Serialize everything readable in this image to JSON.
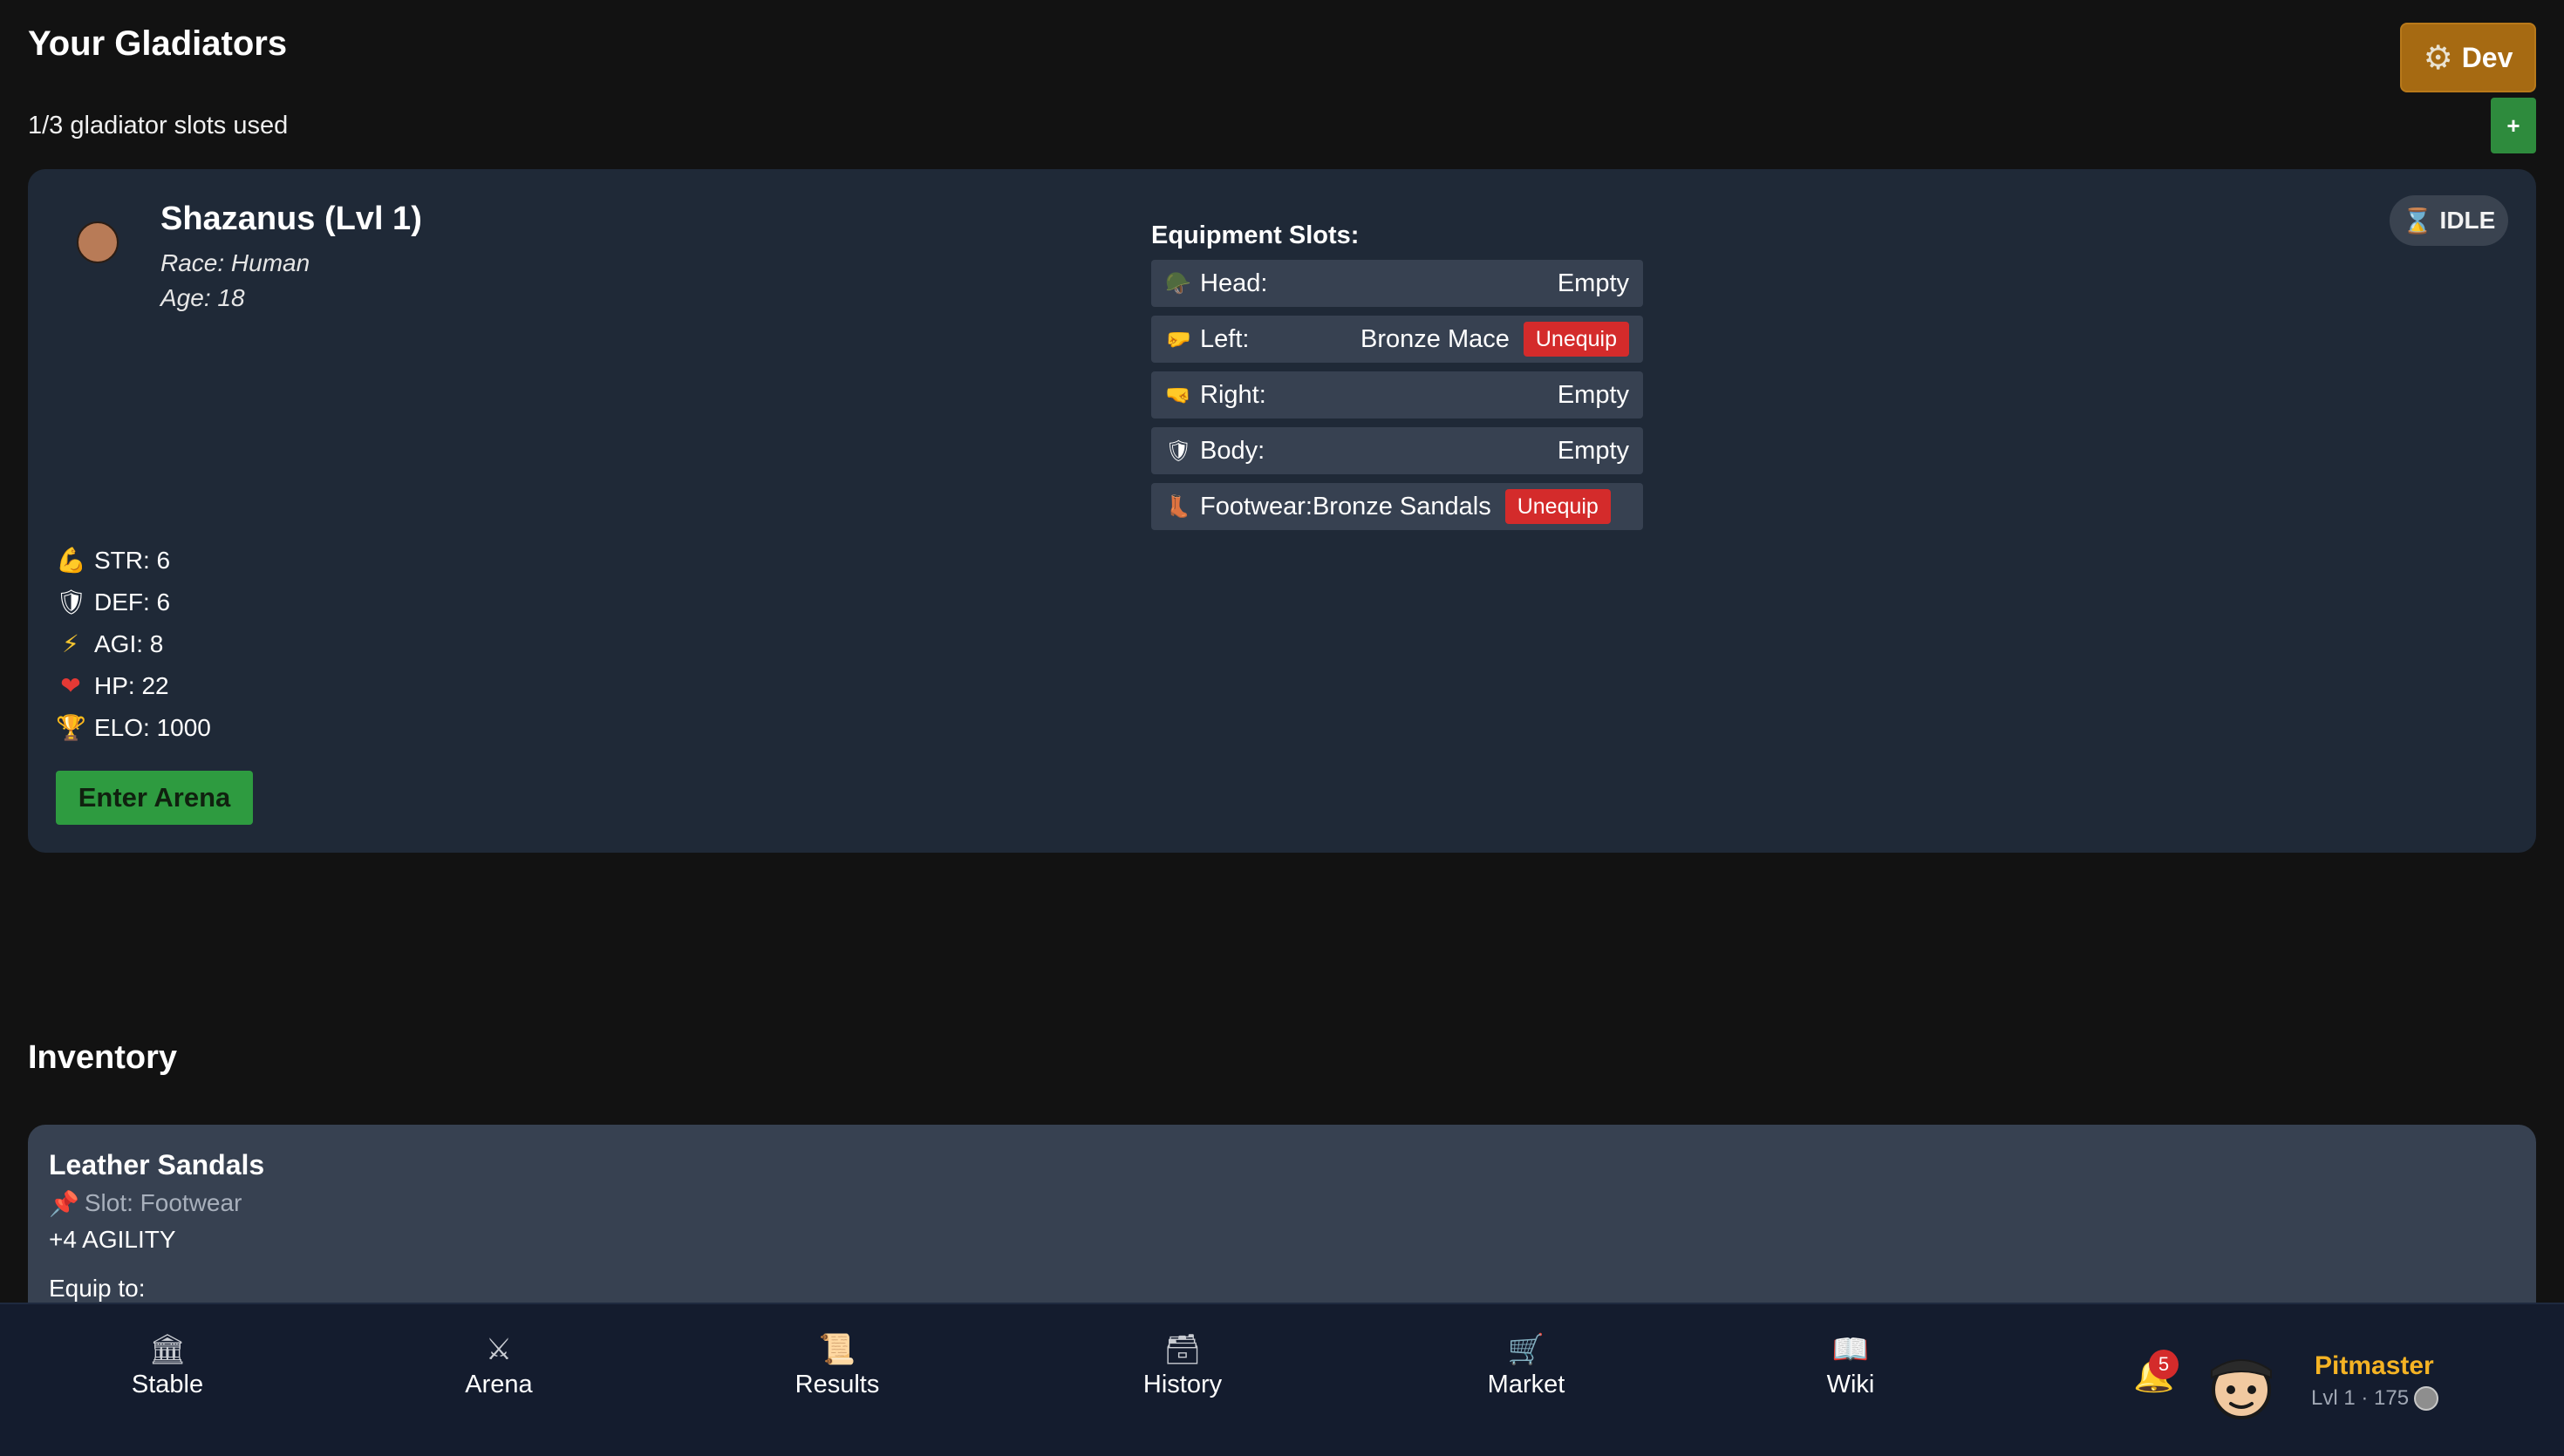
{
  "header": {
    "title": "Your Gladiators",
    "dev_label": "Dev",
    "slots_text": "1/3 gladiator slots used",
    "add_label": "+"
  },
  "gladiator": {
    "name": "Shazanus (Lvl 1)",
    "race": "Race: Human",
    "age": "Age: 18",
    "status": "IDLE",
    "avatar_color": "#b87b57",
    "equipment_title": "Equipment Slots:",
    "equipment": [
      {
        "icon": "helmet-icon",
        "glyph": "🪖",
        "label": "Head:",
        "value": "Empty",
        "unequip": ""
      },
      {
        "icon": "left-hand-icon",
        "glyph": "🤛",
        "label": "Left:",
        "value": "Bronze Mace",
        "unequip": "Unequip"
      },
      {
        "icon": "right-hand-icon",
        "glyph": "🤜",
        "label": "Right:",
        "value": "Empty",
        "unequip": ""
      },
      {
        "icon": "shield-icon",
        "glyph": "🛡",
        "label": "Body:",
        "value": "Empty",
        "unequip": ""
      },
      {
        "icon": "boot-icon",
        "glyph": "👢",
        "label": "Footwear:",
        "value": "Bronze Sandals",
        "unequip": "Unequip"
      }
    ],
    "stats": [
      {
        "icon": "muscle-icon",
        "glyph": "💪",
        "text": "STR: 6"
      },
      {
        "icon": "shield-icon",
        "glyph": "🛡",
        "text": "DEF: 6"
      },
      {
        "icon": "lightning-icon",
        "glyph": "⚡",
        "text": "AGI: 8"
      },
      {
        "icon": "heart-icon",
        "glyph": "❤",
        "text": "HP: 22"
      },
      {
        "icon": "trophy-icon",
        "glyph": "🏆",
        "text": "ELO: 1000"
      }
    ],
    "arena_button": "Enter Arena"
  },
  "inventory": {
    "title": "Inventory",
    "item": {
      "name": "Leather Sandals",
      "slot": "Slot: Footwear",
      "bonus": "+4 AGILITY",
      "equip_label": "Equip to:"
    }
  },
  "nav": [
    {
      "icon": "temple-icon",
      "glyph": "🏛",
      "label": "Stable"
    },
    {
      "icon": "crossed-swords-icon",
      "glyph": "⚔",
      "label": "Arena"
    },
    {
      "icon": "scroll-icon",
      "glyph": "📜",
      "label": "Results"
    },
    {
      "icon": "archive-box-icon",
      "glyph": "🗃",
      "label": "History"
    },
    {
      "icon": "cart-icon",
      "glyph": "🛒",
      "label": "Market"
    },
    {
      "icon": "book-icon",
      "glyph": "📖",
      "label": "Wiki"
    }
  ],
  "user": {
    "notification_count": "5",
    "name": "Pitmaster",
    "meta": "Lvl 1 · 175"
  },
  "colors": {
    "background": "#121212",
    "card": "#1f2937",
    "accent_green": "#2e9b40",
    "unequip_red": "#d42b2b",
    "dev_gold": "#a66a12",
    "username_gold": "#f5b324"
  }
}
